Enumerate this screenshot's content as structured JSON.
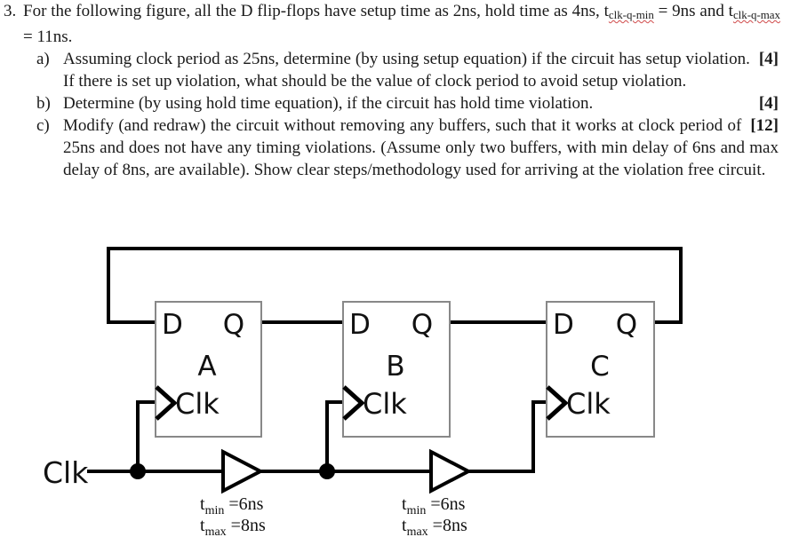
{
  "question": {
    "number": "3.",
    "stem_part1": "For the following figure, all the D flip-flops have setup time as 2ns, hold time as 4ns, t",
    "stem_sub1": "clk-q-min",
    "stem_part2": " = 9ns and t",
    "stem_sub2": "clk-q-max",
    "stem_part3": " = 11ns.",
    "parts": [
      {
        "label": "a)",
        "text": "Assuming clock period as 25ns, determine (by using setup equation) if the circuit has setup violation. If there is set up violation, what should be the value of clock period to avoid setup violation.",
        "marks": "[4]"
      },
      {
        "label": "b)",
        "text": "Determine (by using hold time equation), if the circuit has hold time violation.",
        "marks": "[4]"
      },
      {
        "label": "c)",
        "text": "Modify (and redraw) the circuit without removing any buffers, such that it works at clock period of 25ns and does not have any timing violations. (Assume only two buffers, with min delay of 6ns and max delay of 8ns, are available).  Show clear steps/methodology used for arriving at the violation free circuit.",
        "marks": "[12]"
      }
    ]
  },
  "circuit": {
    "clock_source_label": "Clk",
    "flipflops": [
      {
        "name": "A",
        "d_label": "D",
        "q_label": "Q",
        "clk_label": "Clk"
      },
      {
        "name": "B",
        "d_label": "D",
        "q_label": "Q",
        "clk_label": "Clk"
      },
      {
        "name": "C",
        "d_label": "D",
        "q_label": "Q",
        "clk_label": "Clk"
      }
    ],
    "buffers": [
      {
        "tmin": "t",
        "tmin_sub": "min",
        "tmin_val": " =6ns",
        "tmax": "t",
        "tmax_sub": "max",
        "tmax_val": " =8ns"
      },
      {
        "tmin": "t",
        "tmin_sub": "min",
        "tmin_val": " =6ns",
        "tmax": "t",
        "tmax_sub": "max",
        "tmax_val": " =8ns"
      }
    ],
    "colors": {
      "wire": "#000000",
      "box_border": "#777777",
      "text": "#111111",
      "background": "#ffffff"
    }
  }
}
